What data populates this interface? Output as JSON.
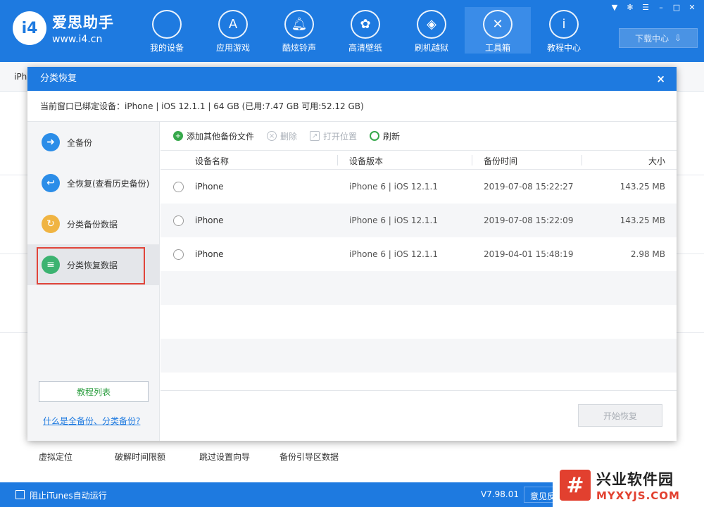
{
  "app": {
    "logo_mark": "i4",
    "name": "爱思助手",
    "url": "www.i4.cn"
  },
  "nav": [
    {
      "label": "我的设备",
      "icon": "apple-icon"
    },
    {
      "label": "应用游戏",
      "icon": "appstore-icon"
    },
    {
      "label": "酷炫铃声",
      "icon": "bell-icon"
    },
    {
      "label": "高清壁纸",
      "icon": "flower-icon"
    },
    {
      "label": "刷机越狱",
      "icon": "box-icon"
    },
    {
      "label": "工具箱",
      "icon": "tools-icon"
    },
    {
      "label": "教程中心",
      "icon": "info-icon"
    }
  ],
  "header": {
    "download_label": "下载中心"
  },
  "background": {
    "tab_label": "iPh",
    "tools": [
      "虚拟定位",
      "破解时间限额",
      "跳过设置向导",
      "备份引导区数据"
    ]
  },
  "dialog": {
    "title": "分类恢复",
    "close": "×",
    "device_info": "当前窗口已绑定设备：iPhone  |  iOS 12.1.1  |  64 GB (已用:7.47 GB 可用:52.12 GB)",
    "side_items": [
      {
        "label": "全备份",
        "icon": "arrow-right-icon",
        "color": "#2b8de8"
      },
      {
        "label": "全恢复(查看历史备份)",
        "icon": "arrow-back-icon",
        "color": "#2b8de8"
      },
      {
        "label": "分类备份数据",
        "icon": "backup-category-icon",
        "color": "#f0b442"
      },
      {
        "label": "分类恢复数据",
        "icon": "restore-category-icon",
        "color": "#3cb371"
      }
    ],
    "tutorial_button": "教程列表",
    "help_link": "什么是全备份、分类备份?",
    "toolbar": {
      "add": "添加其他备份文件",
      "delete": "删除",
      "open": "打开位置",
      "refresh": "刷新"
    },
    "columns": [
      "设备名称",
      "设备版本",
      "备份时间",
      "大小"
    ],
    "rows": [
      {
        "name": "iPhone",
        "version": "iPhone 6 | iOS 12.1.1",
        "time": "2019-07-08 15:22:27",
        "size": "143.25 MB"
      },
      {
        "name": "iPhone",
        "version": "iPhone 6 | iOS 12.1.1",
        "time": "2019-07-08 15:22:09",
        "size": "143.25 MB"
      },
      {
        "name": "iPhone",
        "version": "iPhone 6 | iOS 12.1.1",
        "time": "2019-04-01 15:48:19",
        "size": "2.98 MB"
      }
    ],
    "start_button": "开始恢复"
  },
  "statusbar": {
    "itunes_label": "阻止iTunes自动运行",
    "version": "V7.98.01",
    "feedback": "意见反"
  },
  "watermark": {
    "title": "兴业软件园",
    "url": "MYXYJS.COM"
  },
  "colors": {
    "brand": "#1e7ae0",
    "highlight": "#e0443a",
    "green": "#36a84b"
  }
}
